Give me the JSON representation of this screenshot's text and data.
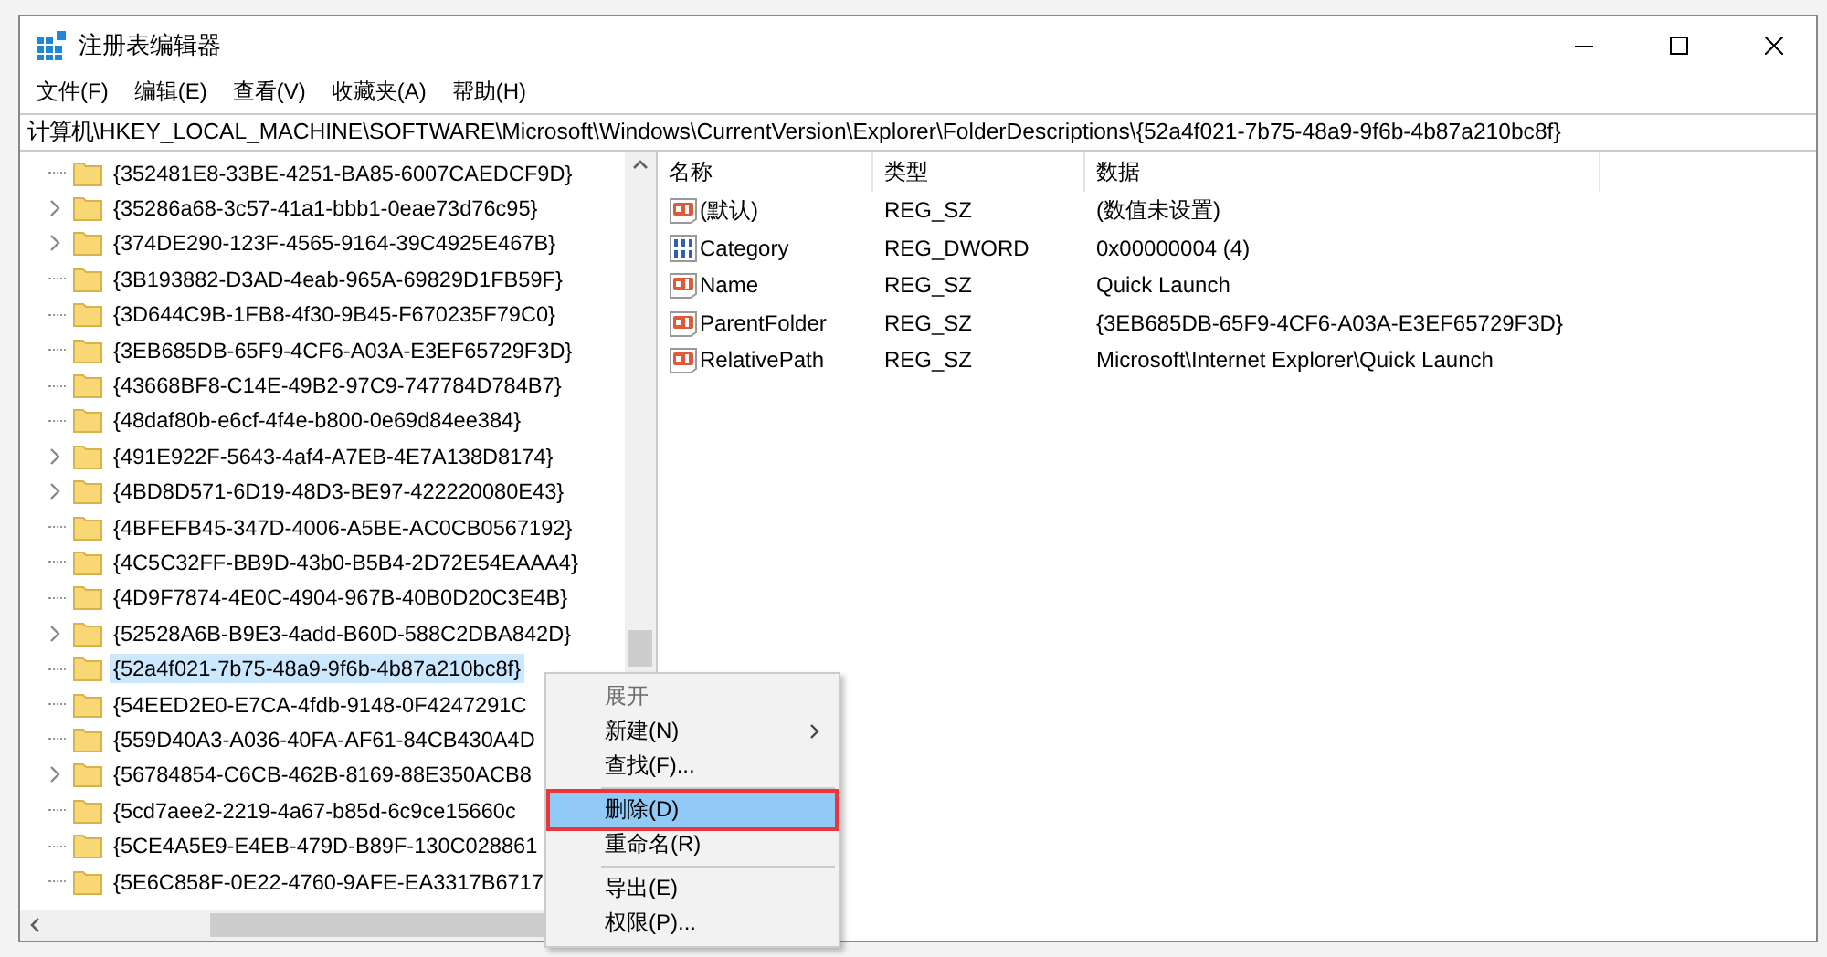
{
  "window": {
    "title": "注册表编辑器"
  },
  "menu_bar": [
    "文件(F)",
    "编辑(E)",
    "查看(V)",
    "收藏夹(A)",
    "帮助(H)"
  ],
  "address": "计算机\\HKEY_LOCAL_MACHINE\\SOFTWARE\\Microsoft\\Windows\\CurrentVersion\\Explorer\\FolderDescriptions\\{52a4f021-7b75-48a9-9f6b-4b87a210bc8f}",
  "tree": [
    {
      "label": "{352481E8-33BE-4251-BA85-6007CAEDCF9D}",
      "expandable": false,
      "selected": false
    },
    {
      "label": "{35286a68-3c57-41a1-bbb1-0eae73d76c95}",
      "expandable": true,
      "selected": false
    },
    {
      "label": "{374DE290-123F-4565-9164-39C4925E467B}",
      "expandable": true,
      "selected": false
    },
    {
      "label": "{3B193882-D3AD-4eab-965A-69829D1FB59F}",
      "expandable": false,
      "selected": false
    },
    {
      "label": "{3D644C9B-1FB8-4f30-9B45-F670235F79C0}",
      "expandable": false,
      "selected": false
    },
    {
      "label": "{3EB685DB-65F9-4CF6-A03A-E3EF65729F3D}",
      "expandable": false,
      "selected": false
    },
    {
      "label": "{43668BF8-C14E-49B2-97C9-747784D784B7}",
      "expandable": false,
      "selected": false
    },
    {
      "label": "{48daf80b-e6cf-4f4e-b800-0e69d84ee384}",
      "expandable": false,
      "selected": false
    },
    {
      "label": "{491E922F-5643-4af4-A7EB-4E7A138D8174}",
      "expandable": true,
      "selected": false
    },
    {
      "label": "{4BD8D571-6D19-48D3-BE97-422220080E43}",
      "expandable": true,
      "selected": false
    },
    {
      "label": "{4BFEFB45-347D-4006-A5BE-AC0CB0567192}",
      "expandable": false,
      "selected": false
    },
    {
      "label": "{4C5C32FF-BB9D-43b0-B5B4-2D72E54EAAA4}",
      "expandable": false,
      "selected": false
    },
    {
      "label": "{4D9F7874-4E0C-4904-967B-40B0D20C3E4B}",
      "expandable": false,
      "selected": false
    },
    {
      "label": "{52528A6B-B9E3-4add-B60D-588C2DBA842D}",
      "expandable": true,
      "selected": false
    },
    {
      "label": "{52a4f021-7b75-48a9-9f6b-4b87a210bc8f}",
      "expandable": false,
      "selected": true
    },
    {
      "label": "{54EED2E0-E7CA-4fdb-9148-0F4247291C",
      "expandable": false,
      "selected": false
    },
    {
      "label": "{559D40A3-A036-40FA-AF61-84CB430A4D",
      "expandable": false,
      "selected": false
    },
    {
      "label": "{56784854-C6CB-462B-8169-88E350ACB8",
      "expandable": true,
      "selected": false
    },
    {
      "label": "{5cd7aee2-2219-4a67-b85d-6c9ce15660c",
      "expandable": false,
      "selected": false
    },
    {
      "label": "{5CE4A5E9-E4EB-479D-B89F-130C028861",
      "expandable": false,
      "selected": false
    },
    {
      "label": "{5E6C858F-0E22-4760-9AFE-EA3317B6717",
      "expandable": false,
      "selected": false
    }
  ],
  "values": {
    "columns": [
      "名称",
      "类型",
      "数据"
    ],
    "rows": [
      {
        "kind": "string",
        "name": "(默认)",
        "type": "REG_SZ",
        "data": "(数值未设置)"
      },
      {
        "kind": "dword",
        "name": "Category",
        "type": "REG_DWORD",
        "data": "0x00000004 (4)"
      },
      {
        "kind": "string",
        "name": "Name",
        "type": "REG_SZ",
        "data": "Quick Launch"
      },
      {
        "kind": "string",
        "name": "ParentFolder",
        "type": "REG_SZ",
        "data": "{3EB685DB-65F9-4CF6-A03A-E3EF65729F3D}"
      },
      {
        "kind": "string",
        "name": "RelativePath",
        "type": "REG_SZ",
        "data": "Microsoft\\Internet Explorer\\Quick Launch"
      }
    ]
  },
  "context_menu": [
    {
      "kind": "item",
      "label": "展开",
      "disabled": true,
      "selected": false,
      "submenu": false
    },
    {
      "kind": "item",
      "label": "新建(N)",
      "disabled": false,
      "selected": false,
      "submenu": true
    },
    {
      "kind": "item",
      "label": "查找(F)...",
      "disabled": false,
      "selected": false,
      "submenu": false
    },
    {
      "kind": "separator"
    },
    {
      "kind": "item",
      "label": "删除(D)",
      "disabled": false,
      "selected": true,
      "submenu": false
    },
    {
      "kind": "item",
      "label": "重命名(R)",
      "disabled": false,
      "selected": false,
      "submenu": false
    },
    {
      "kind": "separator"
    },
    {
      "kind": "item",
      "label": "导出(E)",
      "disabled": false,
      "selected": false,
      "submenu": false
    },
    {
      "kind": "item",
      "label": "权限(P)...",
      "disabled": false,
      "selected": false,
      "submenu": false
    }
  ]
}
